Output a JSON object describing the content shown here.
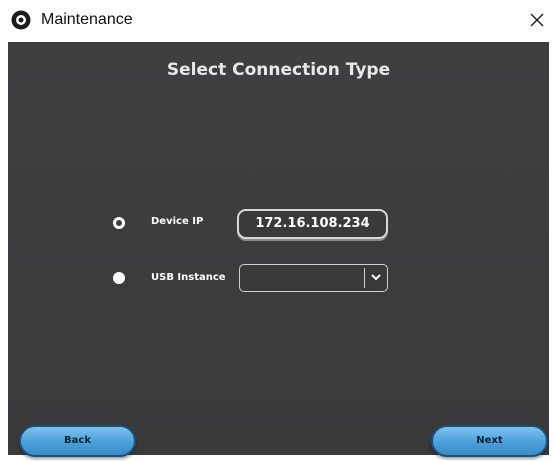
{
  "window": {
    "title": "Maintenance",
    "app_icon": "app-logo-icon",
    "close_icon": "close-icon"
  },
  "main": {
    "heading": "Select Connection Type",
    "options": [
      {
        "label": "Device IP",
        "selected": true,
        "value": "172.16.108.234"
      },
      {
        "label": "USB Instance",
        "selected": false,
        "value": ""
      }
    ],
    "dropdown_icon": "chevron-down-icon"
  },
  "footer": {
    "back_label": "Back",
    "next_label": "Next"
  },
  "colors": {
    "panel_bg": "#3d3d3e",
    "button_blue": "#4a9fd9",
    "text_light": "#ffffff"
  }
}
